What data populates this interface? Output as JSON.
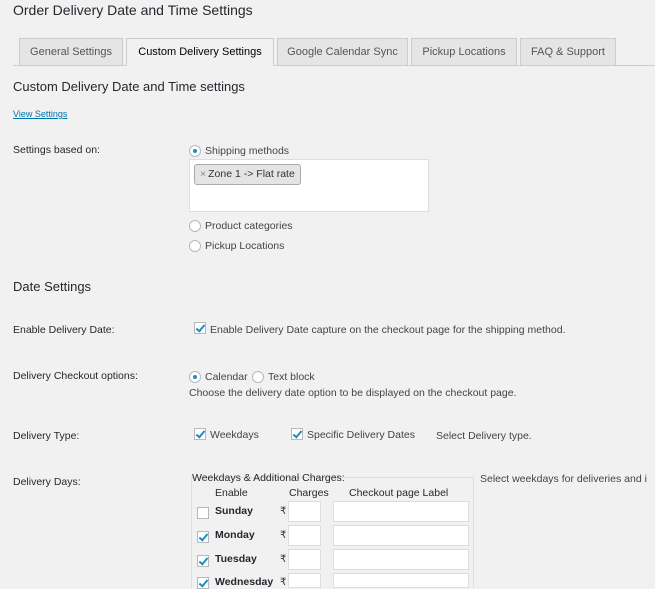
{
  "page": {
    "title": "Order Delivery Date and Time Settings"
  },
  "tabs": [
    {
      "label": "General Settings",
      "active": false
    },
    {
      "label": "Custom Delivery Settings",
      "active": true
    },
    {
      "label": "Google Calendar Sync",
      "active": false
    },
    {
      "label": "Pickup Locations",
      "active": false
    },
    {
      "label": "FAQ & Support",
      "active": false
    }
  ],
  "custom": {
    "heading": "Custom Delivery Date and Time settings",
    "view_link": "View Settings",
    "based_on_label": "Settings based on:",
    "options": [
      {
        "label": "Shipping methods",
        "selected": true
      },
      {
        "label": "Product categories",
        "selected": false
      },
      {
        "label": "Pickup Locations",
        "selected": false
      }
    ],
    "chip_remove": "×",
    "selected_chip": "Zone 1 -> Flat rate"
  },
  "date_settings": {
    "heading": "Date Settings",
    "enable_label": "Enable Delivery Date:",
    "enable_checkbox_label": "Enable Delivery Date capture on the checkout page for the shipping method.",
    "checkout_label": "Delivery Checkout options:",
    "checkout_options": [
      {
        "label": "Calendar",
        "selected": true
      },
      {
        "label": "Text block",
        "selected": false
      }
    ],
    "checkout_help": "Choose the delivery date option to be displayed on the checkout page.",
    "type_label": "Delivery Type:",
    "type_weekdays": "Weekdays",
    "type_specific": "Specific Delivery Dates",
    "type_help": "Select Delivery type.",
    "days_label": "Delivery Days:",
    "days_table_title": "Weekdays & Additional Charges:",
    "days_help": "Select weekdays for deliveries and i",
    "col_enable": "Enable",
    "col_charges": "Charges",
    "col_label": "Checkout page Label",
    "currency": "₹",
    "days": [
      {
        "name": "Sunday",
        "enabled": false
      },
      {
        "name": "Monday",
        "enabled": true
      },
      {
        "name": "Tuesday",
        "enabled": true
      },
      {
        "name": "Wednesday",
        "enabled": true
      }
    ]
  }
}
